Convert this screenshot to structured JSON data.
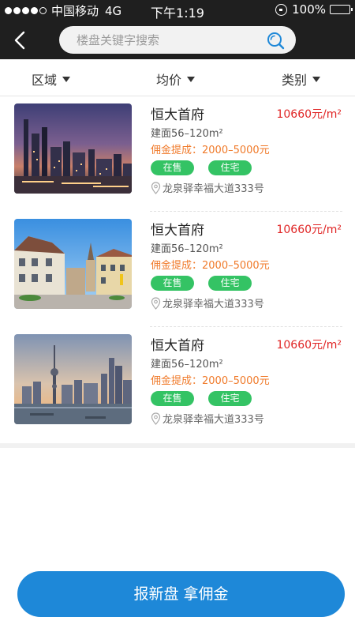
{
  "status_bar": {
    "carrier": "中国移动",
    "network": "4G",
    "time": "下午1:19",
    "battery": "100%"
  },
  "nav": {
    "back_icon": "chevron-left-icon",
    "search": {
      "placeholder": "楼盘关键字搜索",
      "value": "",
      "icon": "search-icon"
    }
  },
  "filters": [
    {
      "label": "区域"
    },
    {
      "label": "均价"
    },
    {
      "label": "类别"
    }
  ],
  "listings": [
    {
      "name": "恒大首府",
      "price": "10660元/m²",
      "area": "建面56–120m²",
      "commission": "佣金提成：2000–5000元",
      "tags": [
        "在售",
        "住宅"
      ],
      "address": "龙泉驿幸福大道333号",
      "image": "night-city-skyline"
    },
    {
      "name": "恒大首府",
      "price": "10660元/m²",
      "area": "建面56–120m²",
      "commission": "佣金提成：2000–5000元",
      "tags": [
        "在售",
        "住宅"
      ],
      "address": "龙泉驿幸福大道333号",
      "image": "european-town-street"
    },
    {
      "name": "恒大首府",
      "price": "10660元/m²",
      "area": "建面56–120m²",
      "commission": "佣金提成：2000–5000元",
      "tags": [
        "在售",
        "住宅"
      ],
      "address": "龙泉驿幸福大道333号",
      "image": "river-city-skyline"
    }
  ],
  "cta": {
    "label": "报新盘 拿佣金"
  },
  "colors": {
    "bar": "#1f1f1f",
    "price": "#e02525",
    "commission": "#f07a2a",
    "tag": "#34c364",
    "cta": "#1e88d8"
  }
}
